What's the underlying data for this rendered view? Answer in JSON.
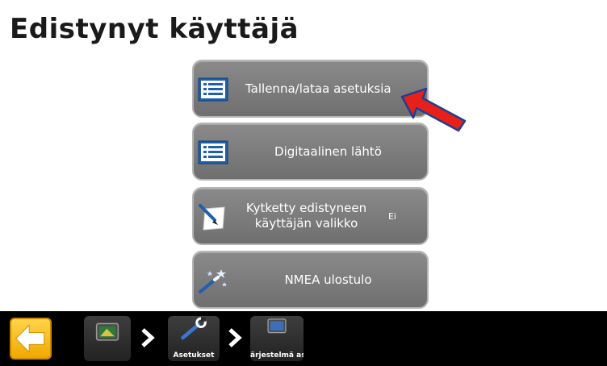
{
  "page": {
    "title": "Edistynyt käyttäjä"
  },
  "menu": [
    {
      "label": "Tallenna/lataa asetuksia",
      "icon": "list-icon"
    },
    {
      "label": "Digitaalinen lähtö",
      "icon": "list-icon"
    },
    {
      "label": "Kytketty edistyneen käyttäjän valikko",
      "value": "Ei",
      "icon": "note-pen-icon"
    },
    {
      "label": "NMEA ulostulo",
      "icon": "magic-wand-icon"
    }
  ],
  "breadcrumb": [
    {
      "label": "",
      "icon": "display-terminal-icon"
    },
    {
      "label": "Asetukset",
      "icon": "wrench-icon"
    },
    {
      "label": "ärjestelmä asetukset",
      "icon": "display-icon"
    }
  ],
  "colors": {
    "button_bg": "#7c7c7c",
    "accent_arrow": "#e8201a",
    "back_button": "#f7b500"
  }
}
